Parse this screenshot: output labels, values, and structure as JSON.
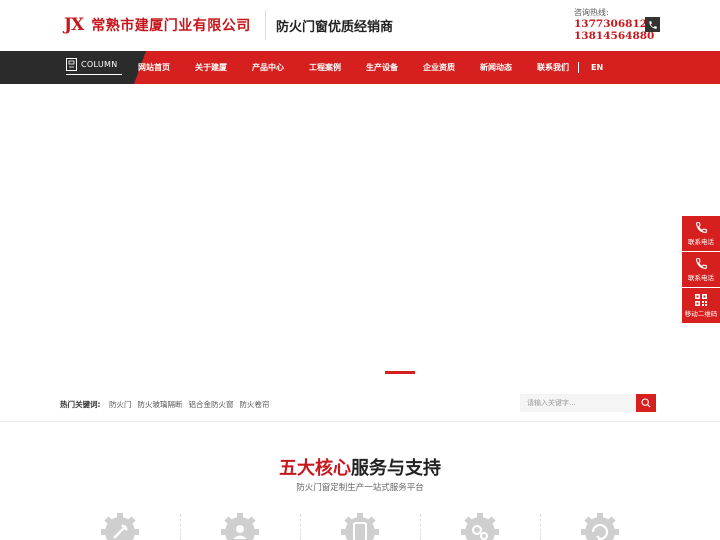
{
  "header": {
    "logo_mark": "JX",
    "company": "常熟市建厦门业有限公司",
    "slogan": "防火门窗优质经销商",
    "hotline_label": "咨询热线:",
    "phones": [
      "13773068126",
      "13814564880"
    ]
  },
  "nav": {
    "column_label": "COLUMN",
    "items": [
      "网站首页",
      "关于建厦",
      "产品中心",
      "工程案例",
      "生产设备",
      "企业资质",
      "新闻动态",
      "联系我们"
    ],
    "lang": "EN"
  },
  "hot": {
    "label": "热门关键词:",
    "keywords": [
      "防火门",
      "防火玻璃隔断",
      "铝合金防火窗",
      "防火卷帘"
    ]
  },
  "search": {
    "placeholder": "请输入关键字..."
  },
  "section": {
    "title_highlight": "五大核心",
    "title_rest": "服务与支持",
    "subtitle": "防火门窗定制生产一站式服务平台"
  },
  "side": {
    "items": [
      "联系电话",
      "联系电话",
      "移动二维码"
    ]
  },
  "colors": {
    "brand_red": "#d6201f",
    "dark": "#2b2b2b"
  }
}
